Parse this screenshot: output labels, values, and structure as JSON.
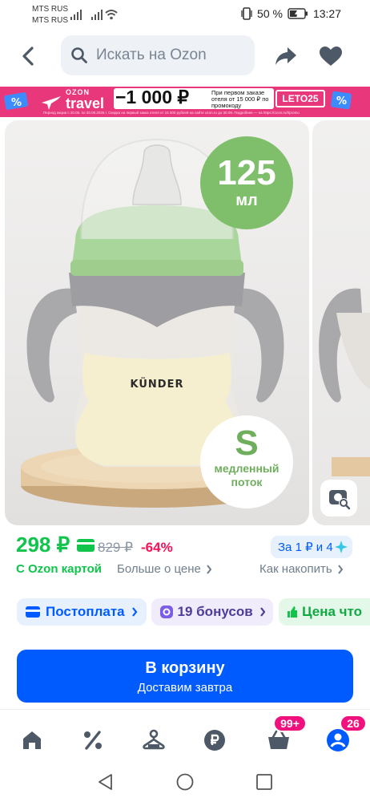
{
  "status_bar": {
    "carrier_1": "MTS RUS",
    "carrier_2": "MTS RUS",
    "battery": "50 %",
    "time": "13:27"
  },
  "header": {
    "search_placeholder": "Искать на Ozon"
  },
  "banner": {
    "brand_top": "OZON",
    "brand_bottom": "travel",
    "amount": "−1 000 ₽",
    "condition": "При первом заказе отеля от 15 000 ₽ по промокоду",
    "promo_code": "LETO25",
    "fine_print": "Период акции с 20.06. по 30.09.2025 г. Скидка на первый заказ отеля от 15 000 рублей на сайте ozon.ru до 30.09. Подробнее — на https://ozon.ru/t/promo"
  },
  "product": {
    "volume_number": "125",
    "volume_unit": "мл",
    "brand_on_bottle": "KÜNDER",
    "flow_size": "S",
    "flow_line_1": "медленный",
    "flow_line_2": "поток"
  },
  "price": {
    "current": "298 ₽",
    "old": "829 ₽",
    "discount": "-64%",
    "with_card": "С Ozon картой",
    "more_about_price": "Больше о цене",
    "installment": "За 1 ₽ и 4",
    "how_to_save": "Как накопить"
  },
  "chips": [
    {
      "label": "Постоплата"
    },
    {
      "label": "19 бонусов"
    },
    {
      "label": "Цена что"
    }
  ],
  "cart": {
    "label": "В корзину",
    "sub": "Доставим завтра"
  },
  "bottom_nav": {
    "cart_badge": "99+",
    "profile_badge": "26"
  },
  "colors": {
    "price_green": "#10c44c",
    "discount_red": "#f91155",
    "ozon_blue": "#005bff",
    "badge_pink": "#f1117e"
  }
}
